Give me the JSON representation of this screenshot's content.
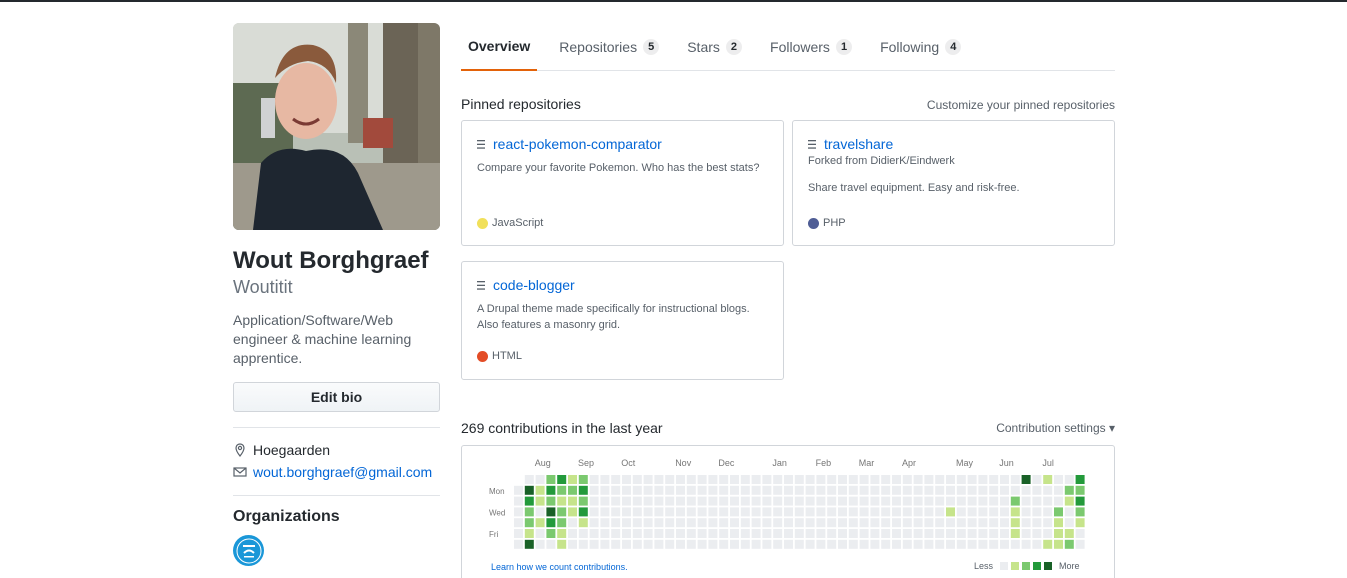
{
  "profile": {
    "full_name": "Wout Borghgraef",
    "username": "Woutitit",
    "bio": "Application/Software/Web engineer & machine learning apprentice.",
    "edit_bio_label": "Edit bio",
    "location": "Hoegaarden",
    "email": "wout.borghgraef@gmail.com",
    "organizations_title": "Organizations",
    "org_logo_text": "Break Life Habits"
  },
  "tabs": [
    {
      "label": "Overview",
      "count": ""
    },
    {
      "label": "Repositories",
      "count": "5"
    },
    {
      "label": "Stars",
      "count": "2"
    },
    {
      "label": "Followers",
      "count": "1"
    },
    {
      "label": "Following",
      "count": "4"
    }
  ],
  "pinned": {
    "title": "Pinned repositories",
    "customize": "Customize your pinned repositories",
    "repos": [
      {
        "name": "react-pokemon-comparator",
        "forked": "",
        "description": "Compare your favorite Pokemon. Who has the best stats?",
        "language": "JavaScript",
        "color": "#f1e05a"
      },
      {
        "name": "travelshare",
        "forked": "Forked from DidierK/Eindwerk",
        "description": "Share travel equipment. Easy and risk-free.",
        "language": "PHP",
        "color": "#4F5D95"
      },
      {
        "name": "code-blogger",
        "forked": "",
        "description": "A Drupal theme made specifically for instructional blogs. Also features a masonry grid.",
        "language": "HTML",
        "color": "#e34c26"
      }
    ]
  },
  "contributions": {
    "title": "269 contributions in the last year",
    "settings": "Contribution settings",
    "months": [
      "Aug",
      "Sep",
      "Oct",
      "Nov",
      "Dec",
      "Jan",
      "Feb",
      "Mar",
      "Apr",
      "May",
      "Jun",
      "Jul"
    ],
    "days": [
      "Mon",
      "Wed",
      "Fri"
    ],
    "learn": "Learn how we count contributions.",
    "less": "Less",
    "more": "More",
    "colors": [
      "#ebedf0",
      "#c6e48b",
      "#7bc96f",
      "#239a3b",
      "#196127"
    ]
  }
}
